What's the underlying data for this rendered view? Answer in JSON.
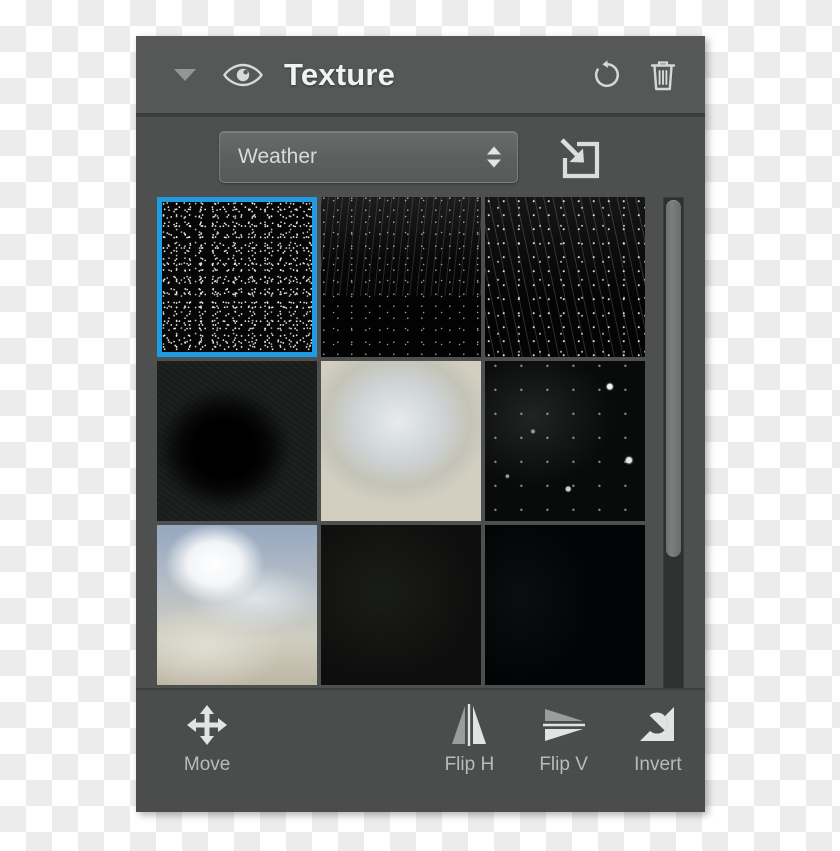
{
  "panel": {
    "title": "Texture",
    "header_icons": {
      "disclosure": "chevron-down-icon",
      "visibility": "eye-icon",
      "reset": "reset-circular-arrow-icon",
      "delete": "trash-icon"
    }
  },
  "preset": {
    "selected": "Weather",
    "stepper_up": "stepper-up-arrow-icon",
    "stepper_down": "stepper-down-arrow-icon",
    "import_icon": "import-into-square-icon"
  },
  "grid": {
    "selected_index": 0,
    "selection_color": "#1e9ce2",
    "thumbnails": [
      {
        "name": "dense-starfield-texture",
        "fill": "tex-stars-dense"
      },
      {
        "name": "rain-fade-texture",
        "fill": "tex-rain-fade"
      },
      {
        "name": "snow-streak-texture",
        "fill": "tex-snow-streak"
      },
      {
        "name": "dark-vignette-blob-texture",
        "fill": "tex-vignette"
      },
      {
        "name": "frost-grain-texture",
        "fill": "tex-frost"
      },
      {
        "name": "bokeh-specks-texture",
        "fill": "tex-bokeh"
      },
      {
        "name": "cloudy-sky-texture",
        "fill": "tex-clouds"
      },
      {
        "name": "near-black-texture",
        "fill": "tex-nearblack"
      },
      {
        "name": "speck-arc-texture",
        "fill": "tex-specks-arc"
      }
    ],
    "scroll_thumb_fraction": "72.5%"
  },
  "toolbar": {
    "tools": [
      {
        "label": "Move",
        "icon": "move-arrows-icon"
      },
      {
        "label": "Flip H",
        "icon": "flip-horizontal-icon"
      },
      {
        "label": "Flip V",
        "icon": "flip-vertical-icon"
      },
      {
        "label": "Invert",
        "icon": "invert-icon"
      }
    ]
  },
  "colors": {
    "panel_bg": "#4e504f",
    "header_bg": "#565857",
    "toolbar_bg": "#4b4d4c",
    "accent": "#1e9ce2",
    "text": "#f1f2f2",
    "muted_text": "#b8bbba"
  }
}
